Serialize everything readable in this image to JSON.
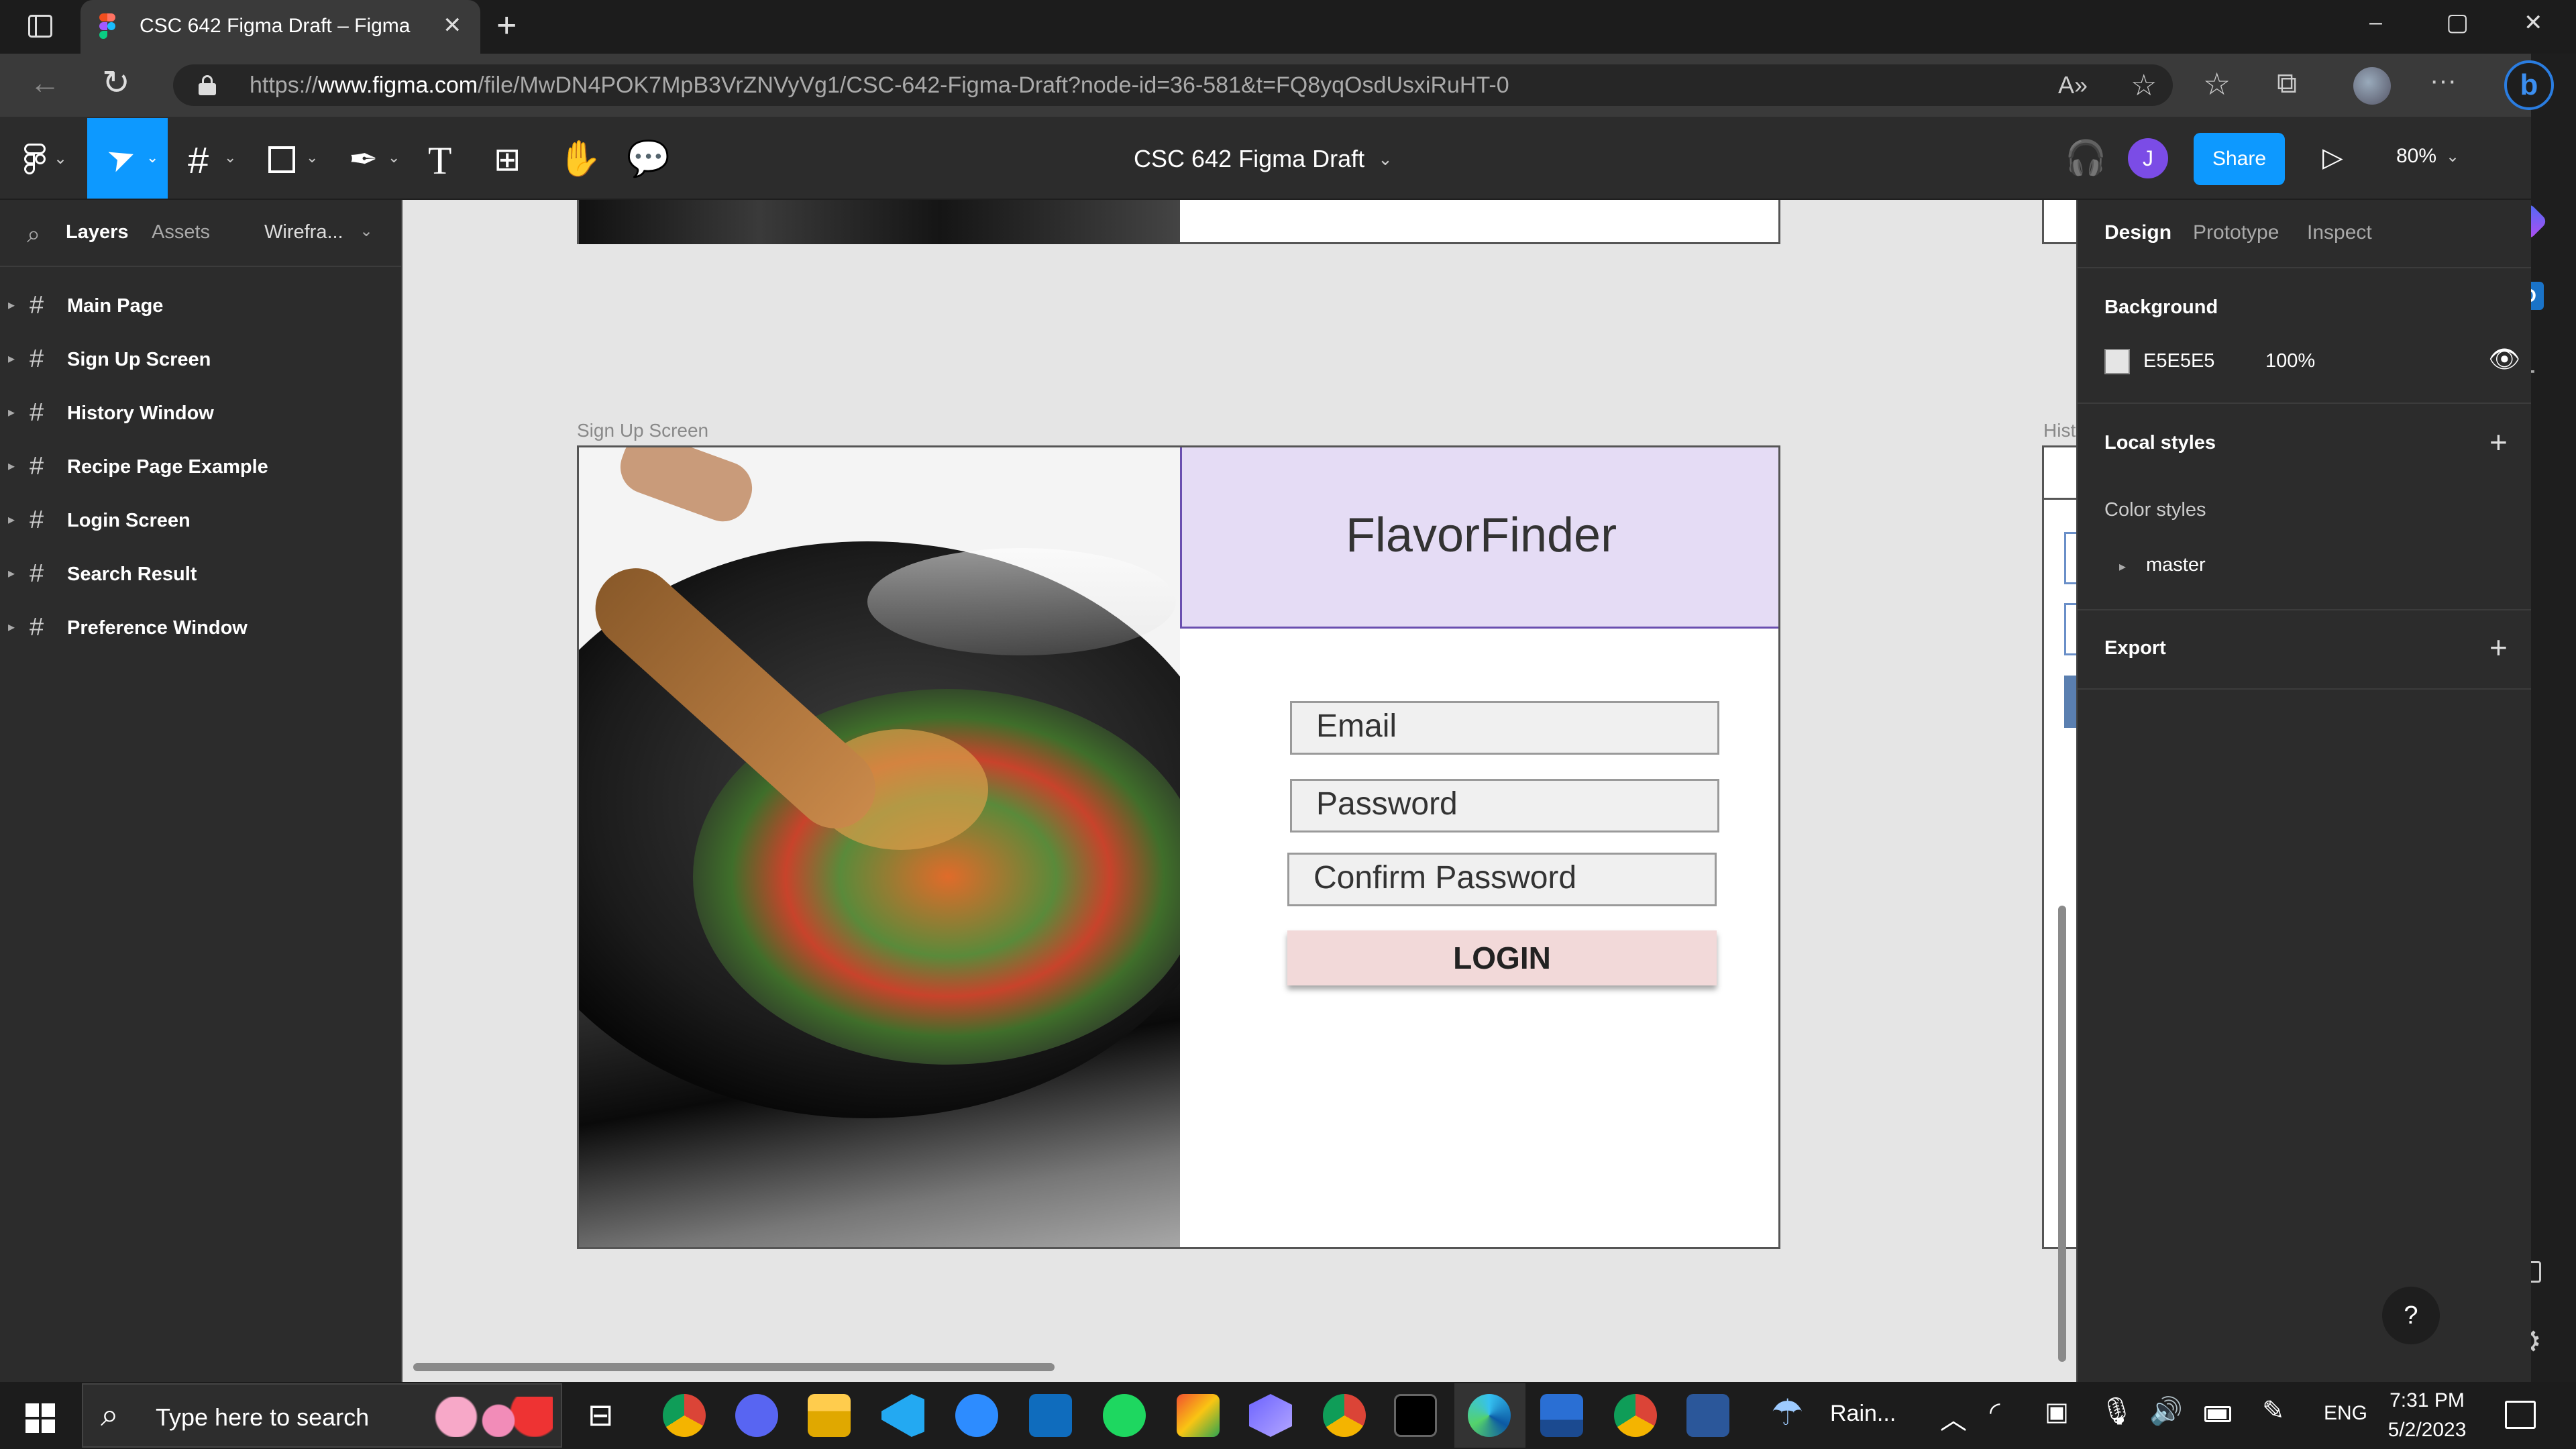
{
  "browser": {
    "tab_title": "CSC 642 Figma Draft – Figma",
    "new_tab": "+",
    "url_prefix": "https://",
    "url_domain": "www.figma.com",
    "url_path": "/file/MwDN4POK7MpB3VrZNVyVg1/CSC-642-Figma-Draft?node-id=36-581&t=FQ8yqOsdUsxiRuHT-0",
    "icons": [
      "sidebar-icon",
      "figma-favicon",
      "close-icon",
      "back-icon",
      "refresh-icon",
      "lock-icon",
      "read-aloud-icon",
      "favorite-add-icon",
      "favorites-icon",
      "collections-icon",
      "profile-icon",
      "more-icon",
      "bing-icon"
    ]
  },
  "window_controls": {
    "minimize": "–",
    "maximize": "▢",
    "close": "✕"
  },
  "toolbar": {
    "file_title": "CSC 642 Figma Draft",
    "user_initial": "J",
    "share_label": "Share",
    "zoom": "80%",
    "accent": "#0d99ff",
    "avatar_color": "#7b4ce6"
  },
  "left_panel": {
    "tabs": [
      "Layers",
      "Assets",
      "Wirefra..."
    ],
    "layers": [
      "Main Page",
      "Sign Up Screen",
      "History Window",
      "Recipe Page Example",
      "Login Screen",
      "Search Result",
      "Preference Window"
    ]
  },
  "canvas": {
    "background": "#E5E5E5",
    "frame_label": "Sign Up Screen",
    "right_frame_label": "Hist",
    "app_title": "FlavorFinder",
    "header_color": "#e5dcf5",
    "fields": [
      "Email",
      "Password",
      "Confirm Password"
    ],
    "button_label": "LOGIN",
    "button_color": "#f2d9d9"
  },
  "right_panel": {
    "tabs": [
      "Design",
      "Prototype",
      "Inspect"
    ],
    "background_title": "Background",
    "background_hex": "E5E5E5",
    "background_opacity": "100%",
    "local_styles_title": "Local styles",
    "color_styles_title": "Color styles",
    "color_style_item": "master",
    "export_title": "Export",
    "help": "?"
  },
  "taskbar": {
    "search_placeholder": "Type here to search",
    "weather": "Rain...",
    "language": "ENG",
    "time": "7:31 PM",
    "date": "5/2/2023"
  }
}
